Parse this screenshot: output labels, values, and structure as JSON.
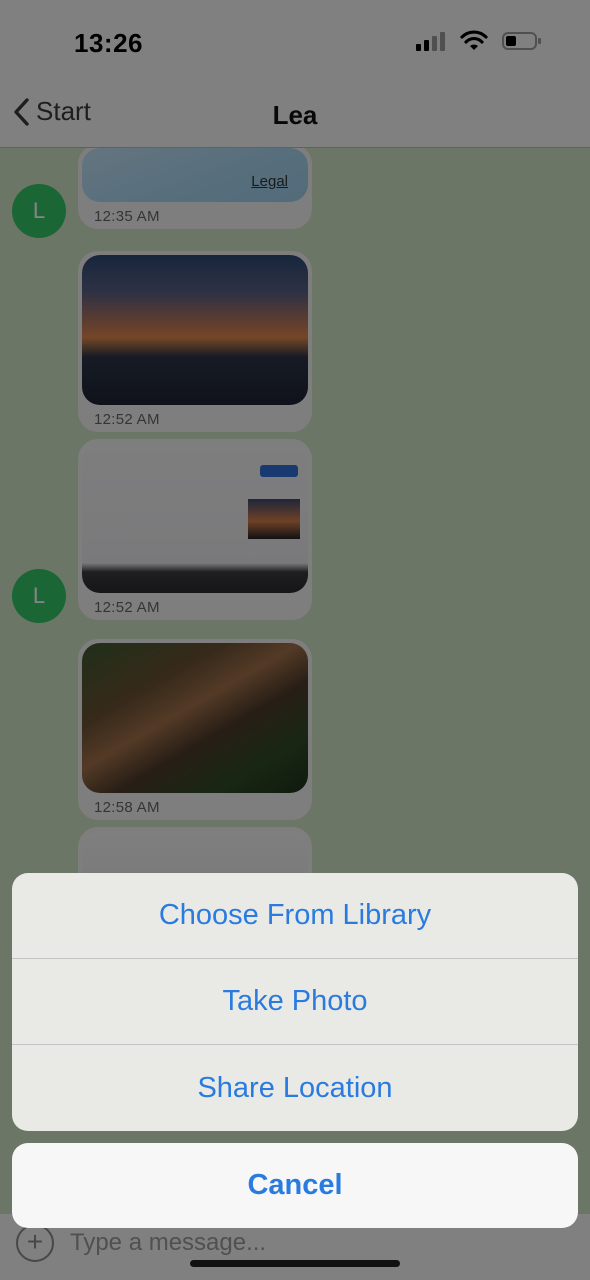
{
  "status_bar": {
    "time": "13:26"
  },
  "nav": {
    "back_label": "Start",
    "title": "Lea"
  },
  "chat": {
    "avatar_letter": "L",
    "messages": [
      {
        "type": "map",
        "legal_label": "Legal",
        "time": "12:35 AM"
      },
      {
        "type": "image",
        "time": "12:52 AM"
      },
      {
        "type": "image",
        "time": "12:52 AM"
      },
      {
        "type": "image",
        "time": "12:58 AM"
      }
    ]
  },
  "input": {
    "placeholder": "Type a message..."
  },
  "action_sheet": {
    "options": [
      "Choose From Library",
      "Take Photo",
      "Share Location"
    ],
    "cancel": "Cancel"
  },
  "colors": {
    "accent": "#2a7be0",
    "avatar": "#32c466"
  }
}
